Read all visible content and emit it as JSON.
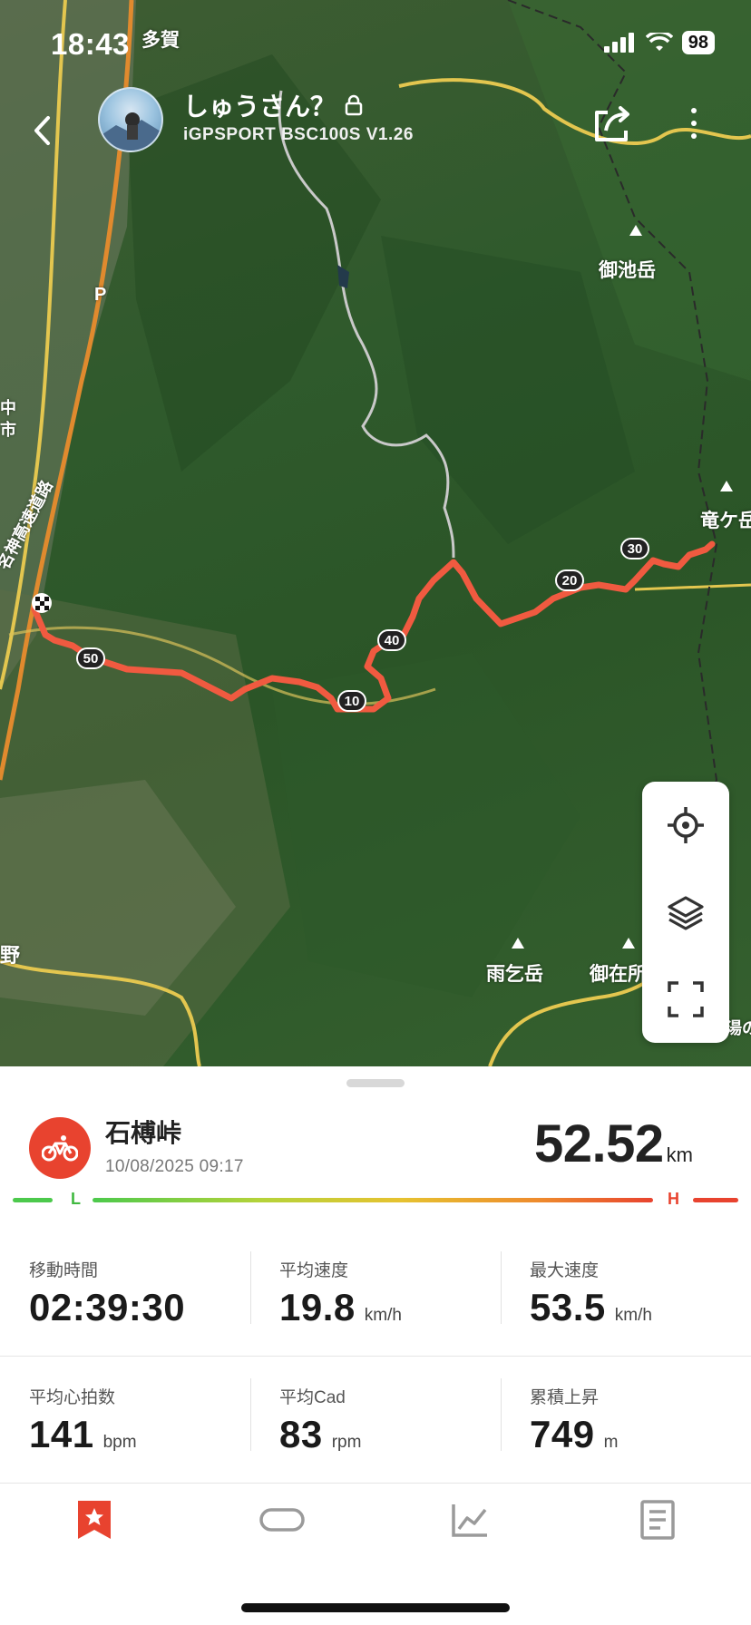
{
  "status_bar": {
    "time": "18:43",
    "battery": "98",
    "signal_icon": "signal-bars-icon",
    "wifi_icon": "wifi-icon"
  },
  "header": {
    "user_name": "しゅうさん？",
    "device": "iGPSPORT BSC100S V1.26",
    "back_icon": "chevron-left-icon",
    "lock_icon": "lock-icon",
    "share_icon": "share-icon",
    "more_icon": "more-vertical-icon"
  },
  "map": {
    "labels": {
      "taga": "多賀",
      "mikeike": "御池岳",
      "ryugatake": "竜ケ岳",
      "amagoi": "雨乞岳",
      "gozaisho": "御在所",
      "highway": "名神高速道路",
      "parking": "P",
      "chu": "中",
      "shi": "市",
      "no": "野",
      "yu": "湯の"
    },
    "km_markers": [
      "10",
      "20",
      "30",
      "40",
      "50"
    ],
    "controls": [
      "locate-icon",
      "layers-icon",
      "fullscreen-icon"
    ]
  },
  "activity": {
    "title": "石榑峠",
    "datetime": "10/08/2025 09:17",
    "distance": "52.52",
    "distance_unit": "km",
    "sport_icon": "bicycle-icon",
    "intensity_low": "L",
    "intensity_high": "H"
  },
  "stats": [
    {
      "label": "移動時間",
      "value": "02:39:30",
      "unit": ""
    },
    {
      "label": "平均速度",
      "value": "19.8",
      "unit": "km/h"
    },
    {
      "label": "最大速度",
      "value": "53.5",
      "unit": "km/h"
    },
    {
      "label": "平均心拍数",
      "value": "141",
      "unit": "bpm"
    },
    {
      "label": "平均Cad",
      "value": "83",
      "unit": "rpm"
    },
    {
      "label": "累積上昇",
      "value": "749",
      "unit": "m"
    }
  ],
  "nav": {
    "items": [
      "bookmark-star-icon",
      "lap-icon",
      "chart-icon",
      "document-icon"
    ],
    "active_color": "#e8432f",
    "inactive_color": "#9a9a9a"
  },
  "colors": {
    "route": "#f0533c",
    "accent": "#e8432f"
  }
}
